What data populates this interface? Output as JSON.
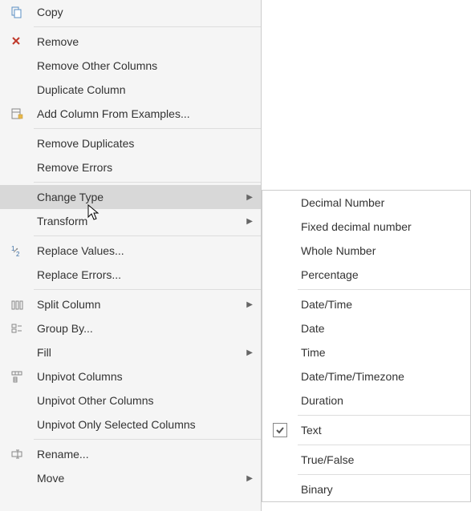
{
  "mainMenu": {
    "copy": "Copy",
    "remove": "Remove",
    "removeOtherColumns": "Remove Other Columns",
    "duplicateColumn": "Duplicate Column",
    "addColumnFromExamples": "Add Column From Examples...",
    "removeDuplicates": "Remove Duplicates",
    "removeErrors": "Remove Errors",
    "changeType": "Change Type",
    "transform": "Transform",
    "replaceValues": "Replace Values...",
    "replaceErrors": "Replace Errors...",
    "splitColumn": "Split Column",
    "groupBy": "Group By...",
    "fill": "Fill",
    "unpivotColumns": "Unpivot Columns",
    "unpivotOtherColumns": "Unpivot Other Columns",
    "unpivotOnlySelected": "Unpivot Only Selected Columns",
    "rename": "Rename...",
    "move": "Move"
  },
  "submenu": {
    "decimalNumber": "Decimal Number",
    "fixedDecimalNumber": "Fixed decimal number",
    "wholeNumber": "Whole Number",
    "percentage": "Percentage",
    "dateTime": "Date/Time",
    "date": "Date",
    "time": "Time",
    "dateTimeTimezone": "Date/Time/Timezone",
    "duration": "Duration",
    "text": "Text",
    "trueFalse": "True/False",
    "binary": "Binary"
  },
  "selected": "text"
}
